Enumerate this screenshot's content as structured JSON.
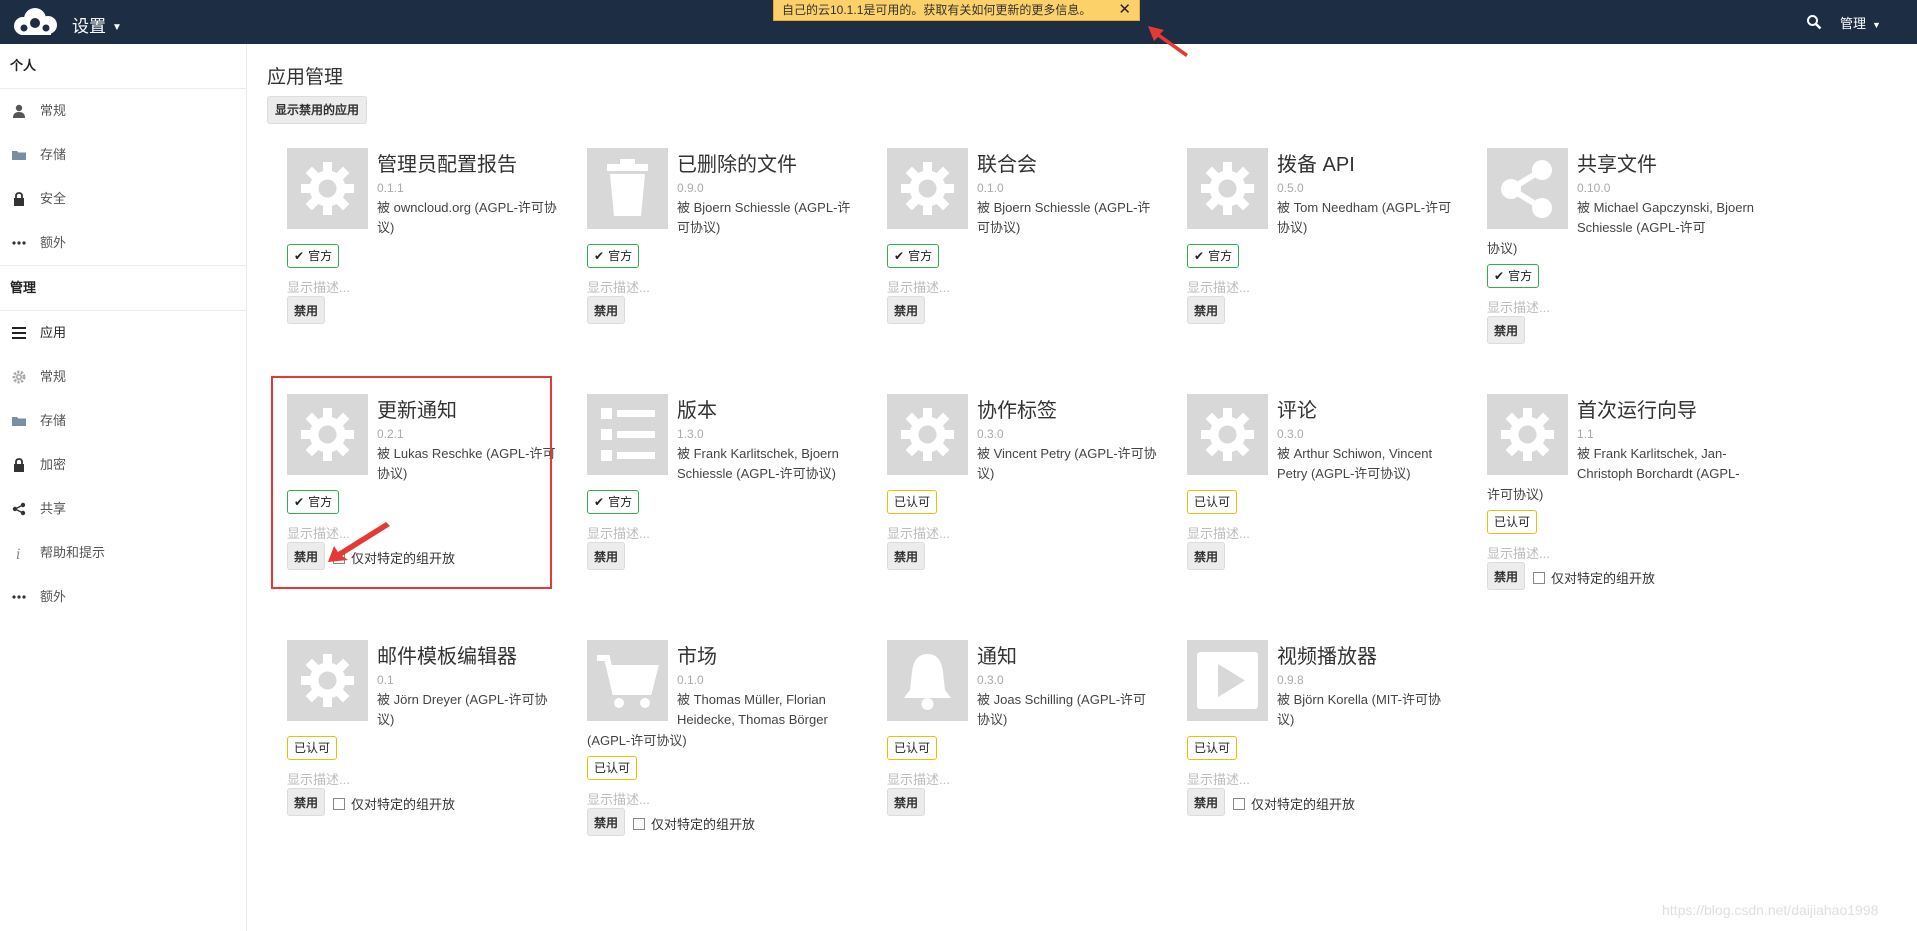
{
  "header": {
    "app_title": "设置",
    "notice": "自己的云10.1.1是可用的。获取有关如何更新的更多信息。",
    "notice_close": "✕",
    "user_menu": "管理"
  },
  "sidebar": {
    "personal_title": "个人",
    "personal_items": [
      {
        "label": "常规"
      },
      {
        "label": "存储"
      },
      {
        "label": "安全"
      },
      {
        "label": "额外"
      }
    ],
    "admin_title": "管理",
    "admin_items": [
      {
        "label": "应用"
      },
      {
        "label": "常规"
      },
      {
        "label": "存储"
      },
      {
        "label": "加密"
      },
      {
        "label": "共享"
      },
      {
        "label": "帮助和提示"
      },
      {
        "label": "额外"
      }
    ]
  },
  "main": {
    "title": "应用管理",
    "show_disabled": "显示禁用的应用",
    "desc_label": "显示描述...",
    "disable_label": "禁用",
    "group_label": "仅对特定的组开放",
    "official_label": "官方",
    "approved_label": "已认可",
    "apps": [
      {
        "name": "管理员配置报告",
        "version": "0.1.1",
        "author": "被 owncloud.org (AGPL-许可协议)"
      },
      {
        "name": "已删除的文件",
        "version": "0.9.0",
        "author": "被 Bjoern Schiessle (AGPL-许可协议)"
      },
      {
        "name": "联合会",
        "version": "0.1.0",
        "author": "被 Bjoern Schiessle (AGPL-许可协议)"
      },
      {
        "name": "拨备 API",
        "version": "0.5.0",
        "author": "被 Tom Needham (AGPL-许可协议)"
      },
      {
        "name": "共享文件",
        "version": "0.10.0",
        "author": "被 Michael Gapczynski, Bjoern Schiessle (AGPL-许可",
        "author_tail": "协议)"
      },
      {
        "name": "更新通知",
        "version": "0.2.1",
        "author": "被 Lukas Reschke (AGPL-许可协议)"
      },
      {
        "name": "版本",
        "version": "1.3.0",
        "author": "被 Frank Karlitschek, Bjoern Schiessle (AGPL-许可协议)"
      },
      {
        "name": "协作标签",
        "version": "0.3.0",
        "author": "被 Vincent Petry (AGPL-许可协议)"
      },
      {
        "name": "评论",
        "version": "0.3.0",
        "author": "被 Arthur Schiwon, Vincent Petry (AGPL-许可协议)"
      },
      {
        "name": "首次运行向导",
        "version": "1.1",
        "author": "被 Frank Karlitschek, Jan-Christoph Borchardt (AGPL-",
        "author_tail": "许可协议)"
      },
      {
        "name": "邮件模板编辑器",
        "version": "0.1",
        "author": "被 Jörn Dreyer (AGPL-许可协议)"
      },
      {
        "name": "市场",
        "version": "0.1.0",
        "author": "被 Thomas Müller, Florian Heidecke, Thomas Börger",
        "author_tail": "(AGPL-许可协议)"
      },
      {
        "name": "通知",
        "version": "0.3.0",
        "author": "被 Joas Schilling (AGPL-许可协议)"
      },
      {
        "name": "视频播放器",
        "version": "0.9.8",
        "author": "被 Björn Korella (MIT-许可协议)"
      }
    ]
  },
  "watermark": "https://blog.csdn.net/daijiahao1998"
}
